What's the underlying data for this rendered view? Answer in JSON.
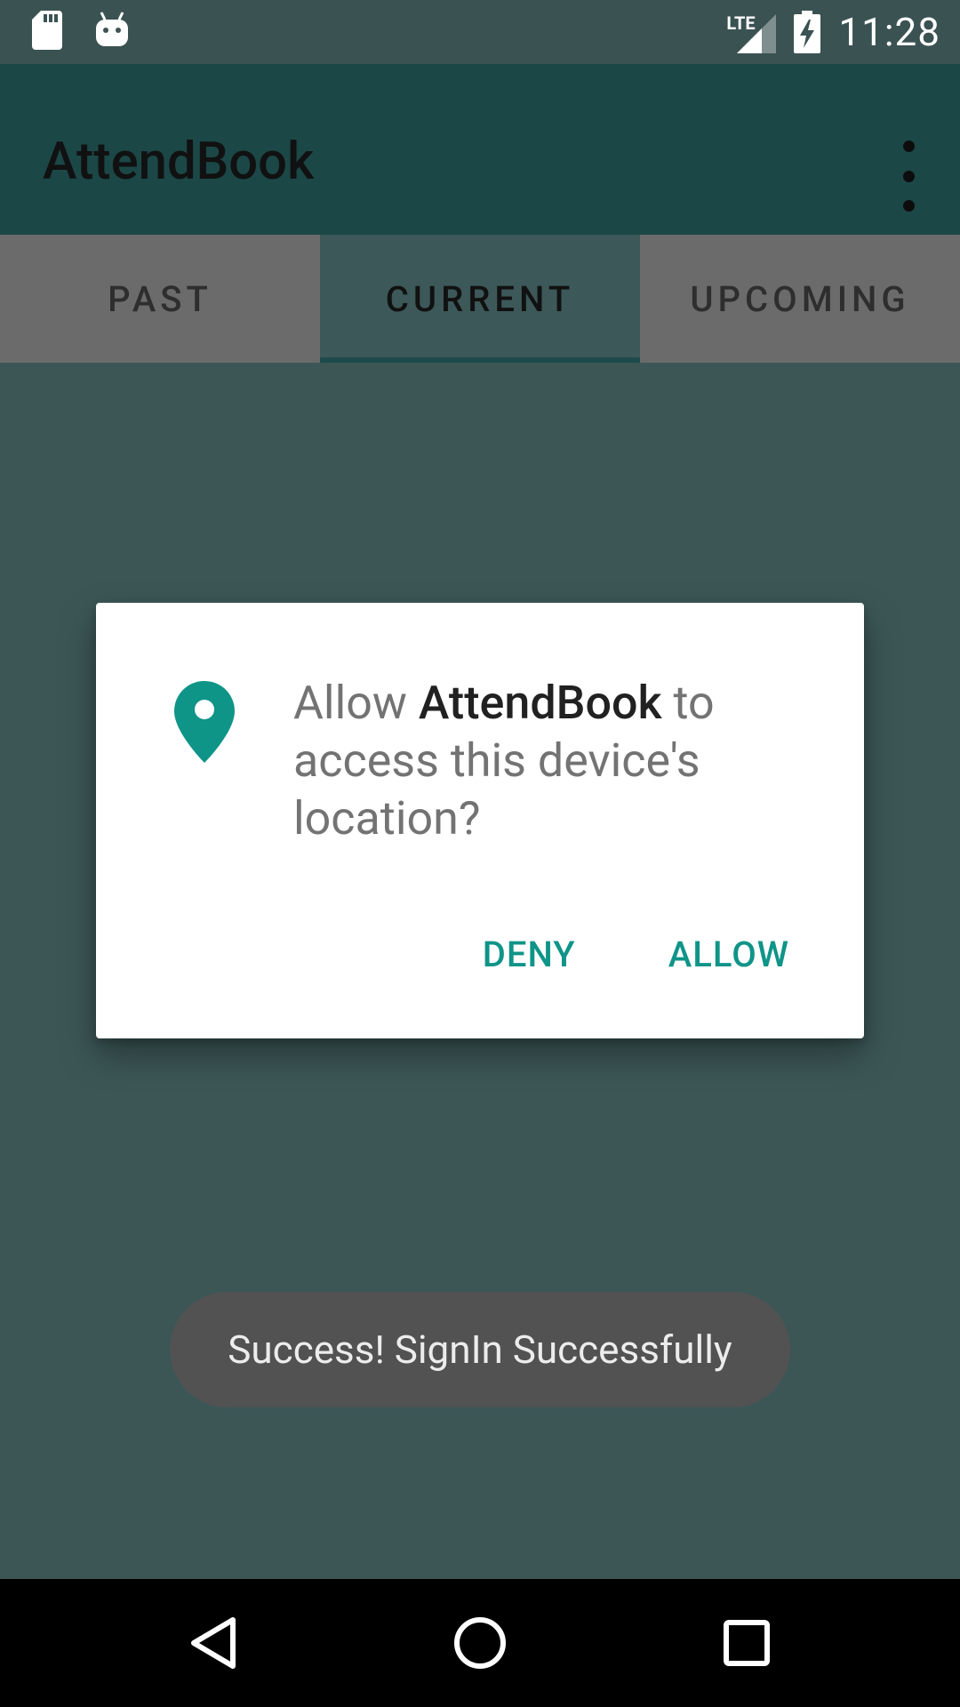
{
  "status_bar": {
    "time": "11:28",
    "network_label": "LTE",
    "icons": [
      "sd-card-icon",
      "android-icon",
      "signal-icon",
      "battery-charging-icon"
    ]
  },
  "app_bar": {
    "title": "AttendBook",
    "overflow_icon": "more-vert-icon"
  },
  "tabs": [
    {
      "label": "PAST",
      "selected": false
    },
    {
      "label": "CURRENT",
      "selected": true
    },
    {
      "label": "UPCOMING",
      "selected": false
    }
  ],
  "dialog": {
    "icon": "location-pin-icon",
    "message_prefix": "Allow ",
    "app_name": "AttendBook",
    "message_suffix": " to access this device's location?",
    "deny_label": "DENY",
    "allow_label": "ALLOW",
    "accent_color": "#0f9488"
  },
  "toast": {
    "message": "Success! SignIn Successfully"
  },
  "nav_bar": {
    "icons": [
      "back-icon",
      "home-icon",
      "recents-icon"
    ]
  },
  "colors": {
    "app_bar": "#1c4747",
    "background_dimmed": "#3c5656",
    "tab_inactive": "#6b6b6b"
  }
}
